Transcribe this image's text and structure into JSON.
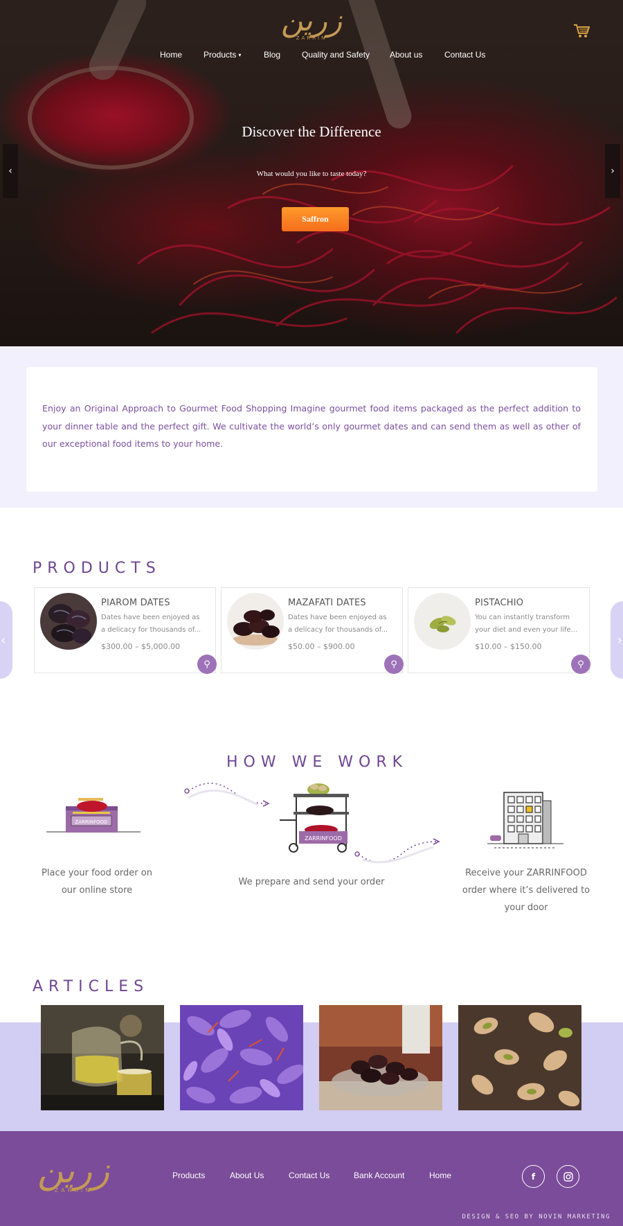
{
  "brand": {
    "logo_text": "زرین",
    "logo_latin": "ZARRIN"
  },
  "nav": {
    "home": "Home",
    "products": "Products",
    "blog": "Blog",
    "quality": "Quality and Safety",
    "about": "About us",
    "contact": "Contact Us"
  },
  "hero": {
    "title": "Discover the Difference",
    "subtitle": "What would you like to taste today?",
    "button": "Saffron"
  },
  "intro": {
    "text": "Enjoy an Original Approach to Gourmet Food Shopping Imagine gourmet food items packaged as the perfect addition to your dinner table and the perfect gift. We cultivate the world’s only gourmet dates and can send them as well as other of our exceptional food items to your home."
  },
  "products": {
    "title": "PRODUCTS",
    "items": [
      {
        "name": "PIAROM DATES",
        "desc": "Dates have been enjoyed as a delicacy for thousands of...",
        "price": "$300.00 – $5,000.00"
      },
      {
        "name": "MAZAFATI DATES",
        "desc": "Dates have been enjoyed as a delicacy for thousands of...",
        "price": "$50.00 – $900.00"
      },
      {
        "name": "PISTACHIO",
        "desc": "You can instantly transform your diet and even your life...",
        "price": "$10.00 – $150.00"
      }
    ]
  },
  "how": {
    "title": "HOW WE WORK",
    "box_label": "ZARRINFOOD",
    "cart_label": "ZARRINFOOD",
    "steps": [
      "Place your food order on our online store",
      "We prepare and send your order",
      "Receive your ZARRINFOOD order where it’s delivered to your door"
    ]
  },
  "articles": {
    "title": "ARTICLES"
  },
  "footer": {
    "links": [
      "Products",
      "About Us",
      "Contact Us",
      "Bank Account",
      "Home"
    ],
    "facebook": "f",
    "credit": "DESIGN & SEO BY NOVIN MARKETING"
  },
  "colors": {
    "purple": "#7b4c99",
    "accent_orange": "#f57d1f",
    "gold": "#c49a55",
    "lavender": "#d2cdf3"
  }
}
